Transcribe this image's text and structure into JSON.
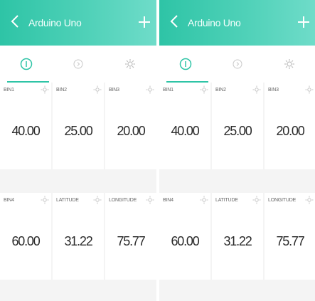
{
  "screens": [
    {
      "header": {
        "title": "Arduino Uno"
      },
      "tabs": [
        {
          "icon": "info-icon",
          "active": true
        },
        {
          "icon": "play-icon",
          "active": false
        },
        {
          "icon": "settings-icon",
          "active": false
        }
      ],
      "cards": [
        {
          "label": "Bin1",
          "value": "40.00"
        },
        {
          "label": "Bin2",
          "value": "25.00"
        },
        {
          "label": "Bin3",
          "value": "20.00"
        },
        {
          "label": "Bin4",
          "value": "60.00"
        },
        {
          "label": "Latitude",
          "value": "31.22"
        },
        {
          "label": "Longitude",
          "value": "75.77"
        }
      ]
    },
    {
      "header": {
        "title": "Arduino Uno"
      },
      "tabs": [
        {
          "icon": "info-icon",
          "active": true
        },
        {
          "icon": "play-icon",
          "active": false
        },
        {
          "icon": "settings-icon",
          "active": false
        }
      ],
      "cards": [
        {
          "label": "Bin1",
          "value": "40.00"
        },
        {
          "label": "Bin2",
          "value": "25.00"
        },
        {
          "label": "Bin3",
          "value": "20.00"
        },
        {
          "label": "Bin4",
          "value": "60.00"
        },
        {
          "label": "Latitude",
          "value": "31.22"
        },
        {
          "label": "Longitude",
          "value": "75.77"
        }
      ]
    }
  ],
  "colors": {
    "accent": "#2ec4a6",
    "header_start": "#2ec4a6",
    "header_end": "#6fdcc9"
  }
}
